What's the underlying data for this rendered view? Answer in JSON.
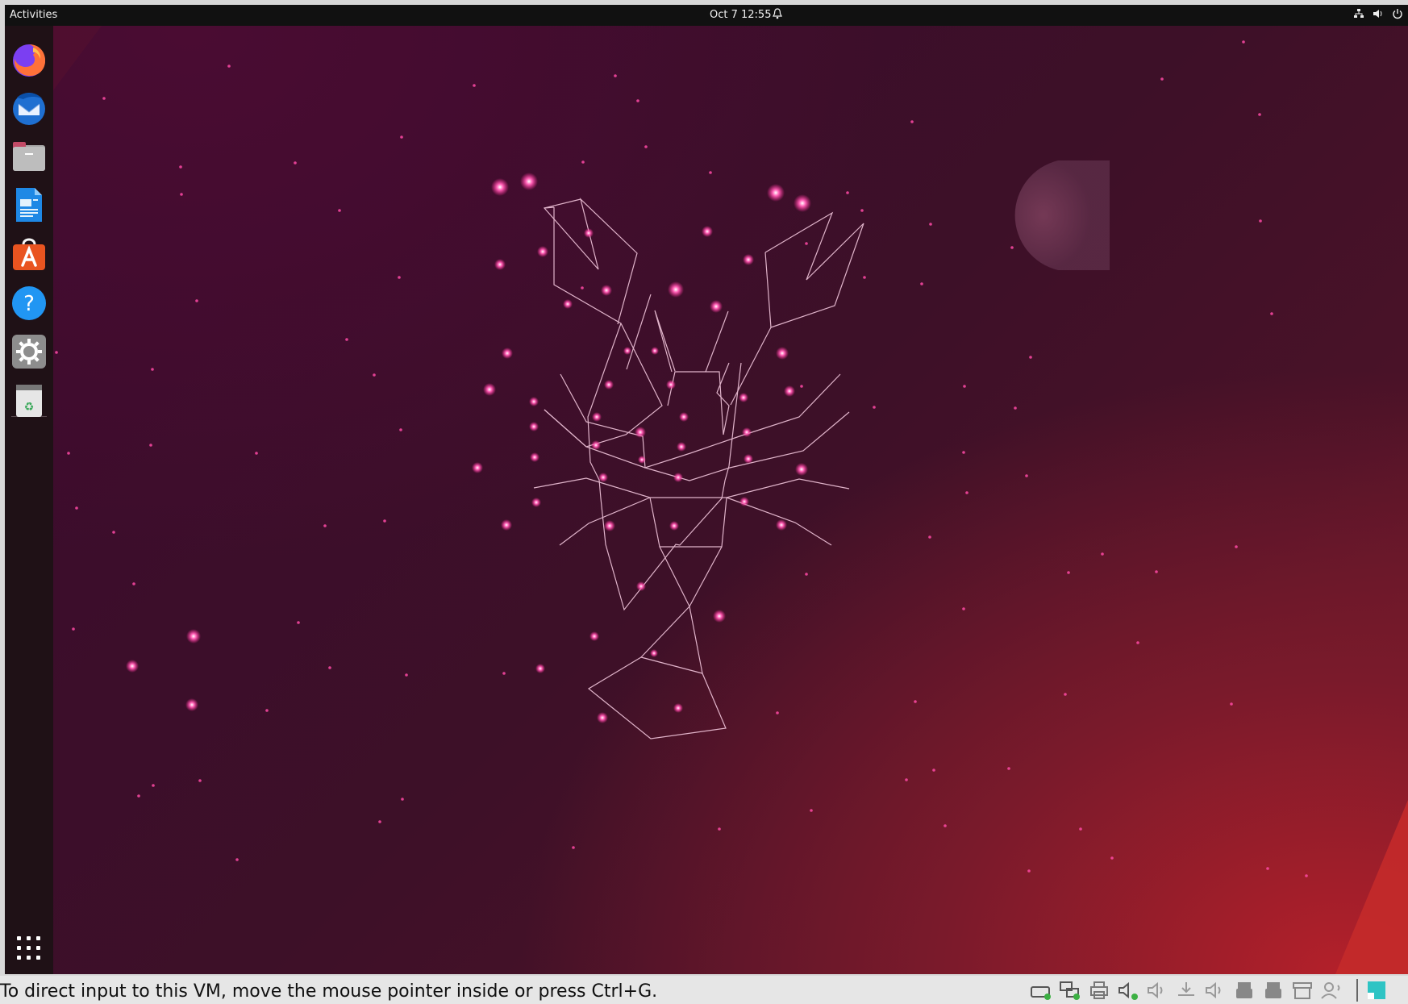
{
  "topbar": {
    "activities": "Activities",
    "clock": "Oct 7  12:55",
    "bell_icon": "bell-icon",
    "tray_icons": [
      "network-icon",
      "volume-icon",
      "power-icon"
    ]
  },
  "dock": {
    "items": [
      {
        "name": "Firefox",
        "icon": "firefox-icon"
      },
      {
        "name": "Thunderbird",
        "icon": "thunderbird-icon"
      },
      {
        "name": "Files",
        "icon": "files-icon"
      },
      {
        "name": "LibreOffice Writer",
        "icon": "writer-icon"
      },
      {
        "name": "Ubuntu Software",
        "icon": "software-icon"
      },
      {
        "name": "Help",
        "icon": "help-icon"
      },
      {
        "name": "Settings",
        "icon": "settings-icon"
      },
      {
        "name": "Trash",
        "icon": "trash-icon"
      }
    ],
    "apps_grid_icon": "show-apps-icon"
  },
  "statusbar": {
    "message": "To direct input to this VM, move the mouse pointer inside or press Ctrl+G.",
    "icons": [
      "hdd-icon",
      "network-adapter-icon",
      "printer-icon",
      "sound-icon",
      "sound-off-icon",
      "usb-download-icon",
      "speaker-icon",
      "usb-icon",
      "usb-icon-2",
      "archive-icon",
      "user-icon",
      "vmware-icon"
    ]
  },
  "colors": {
    "accent": "#e8438a",
    "constellation": "#f0c0d8",
    "topbar": "#111111",
    "dock": "#1f1116"
  }
}
